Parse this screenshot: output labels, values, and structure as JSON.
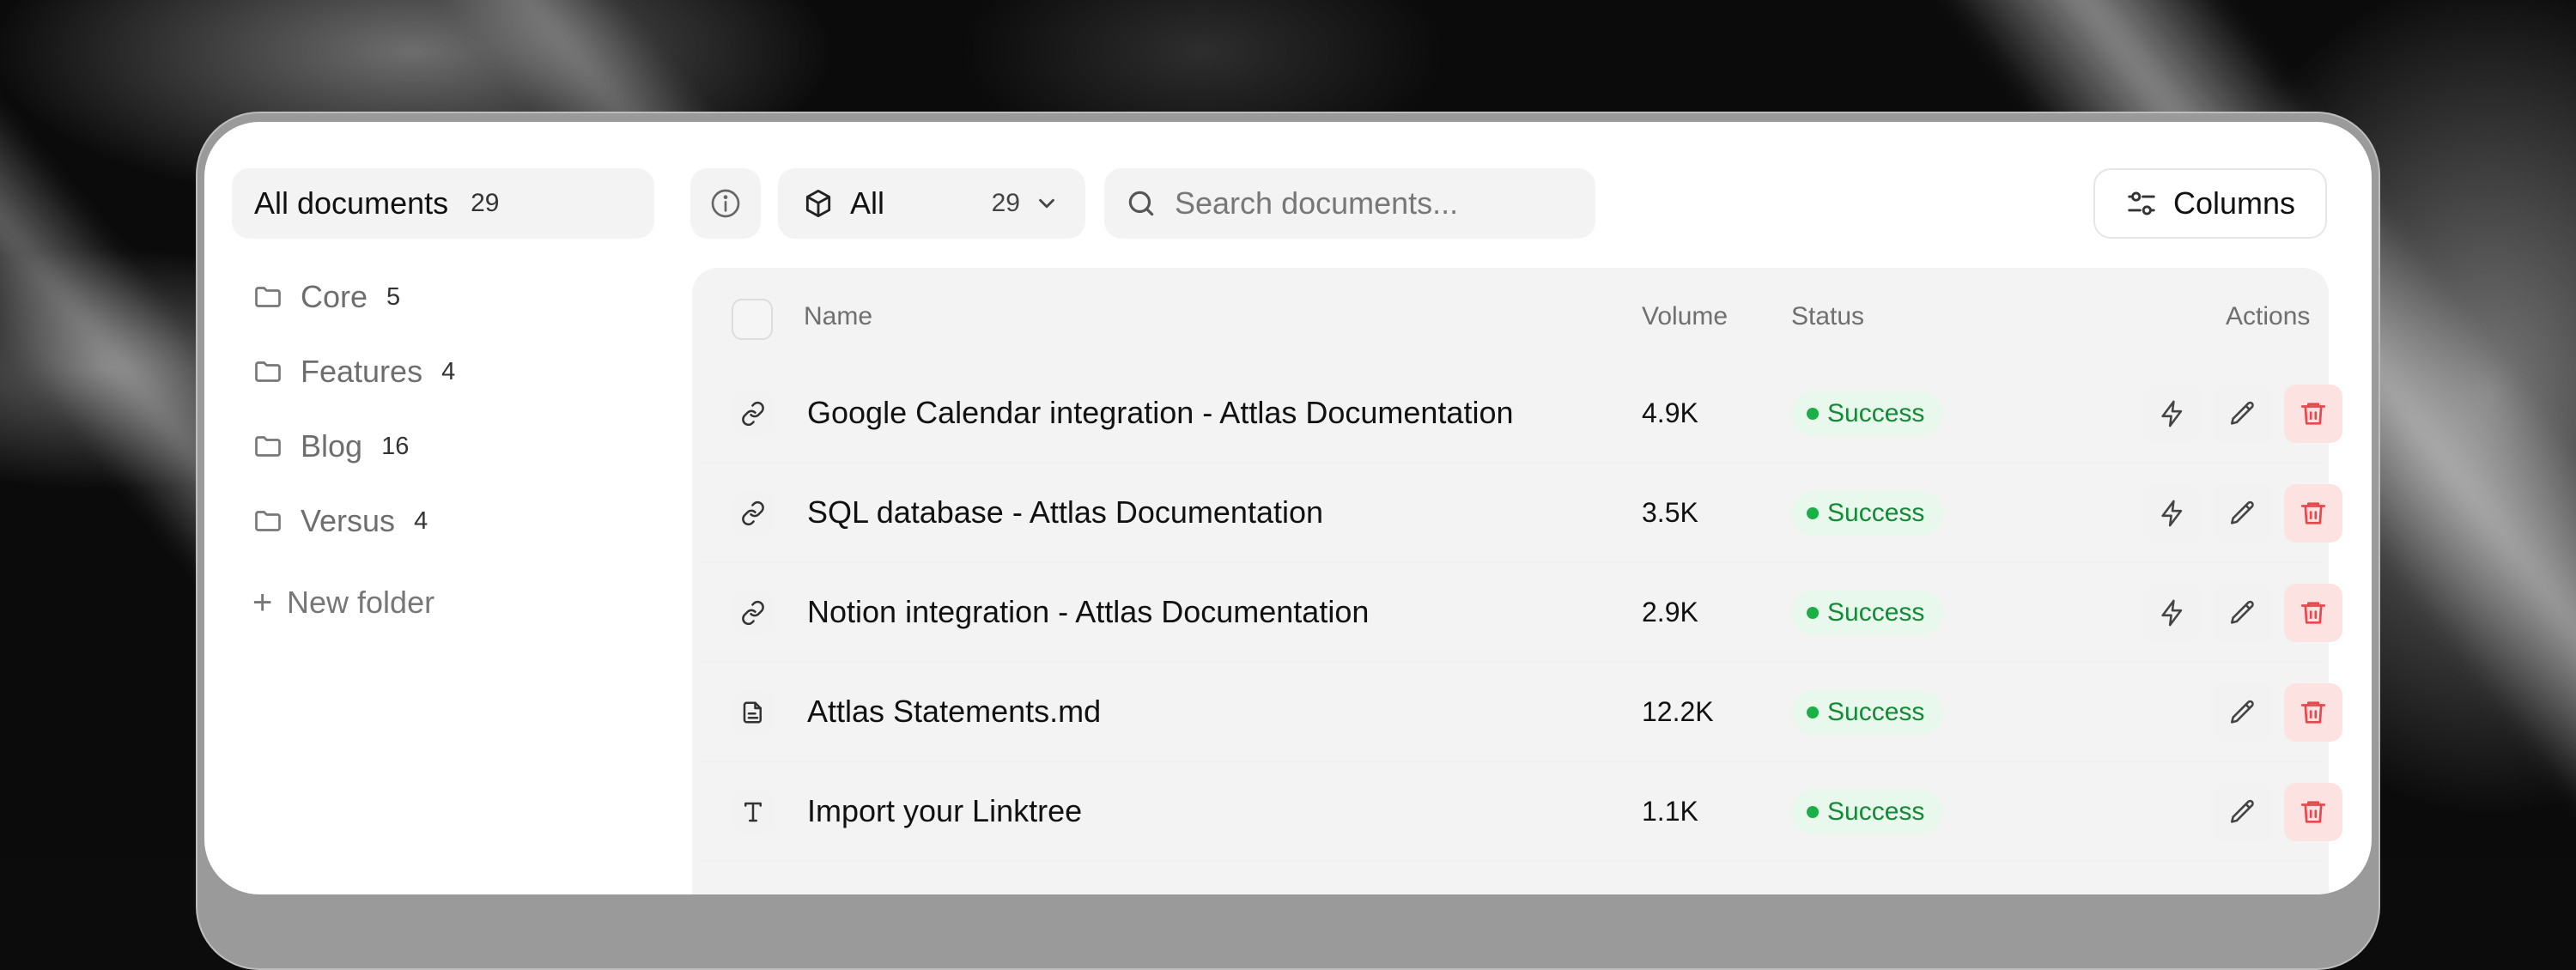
{
  "sidebar": {
    "all_documents": {
      "label": "All documents",
      "count": "29"
    },
    "folders": [
      {
        "label": "Core",
        "count": "5"
      },
      {
        "label": "Features",
        "count": "4"
      },
      {
        "label": "Blog",
        "count": "16"
      },
      {
        "label": "Versus",
        "count": "4"
      }
    ],
    "new_folder": {
      "icon": "plus-icon",
      "label": "New folder"
    }
  },
  "toolbar": {
    "filter": {
      "icon": "box-icon",
      "label": "All",
      "count": "29"
    },
    "search": {
      "icon": "search-icon",
      "placeholder": "Search documents..."
    },
    "columns": {
      "icon": "sliders-icon",
      "label": "Columns"
    }
  },
  "table": {
    "headers": {
      "name": "Name",
      "volume": "Volume",
      "status": "Status",
      "actions": "Actions"
    },
    "rows": [
      {
        "type_icon": "link-icon",
        "name": "Google Calendar integration - Attlas Documentation",
        "volume": "4.9K",
        "status": "Success"
      },
      {
        "type_icon": "link-icon",
        "name": "SQL database - Attlas Documentation",
        "volume": "3.5K",
        "status": "Success"
      },
      {
        "type_icon": "link-icon",
        "name": "Notion integration - Attlas Documentation",
        "volume": "2.9K",
        "status": "Success"
      },
      {
        "type_icon": "file-icon",
        "name": "Attlas Statements.md",
        "volume": "12.2K",
        "status": "Success"
      },
      {
        "type_icon": "text-icon",
        "name": "Import your Linktree",
        "volume": "1.1K",
        "status": "Success"
      }
    ]
  },
  "colors": {
    "success": "#1bb046",
    "success_bg": "#e9f8ed",
    "danger": "#e5484d",
    "danger_bg": "#fde2e2"
  }
}
